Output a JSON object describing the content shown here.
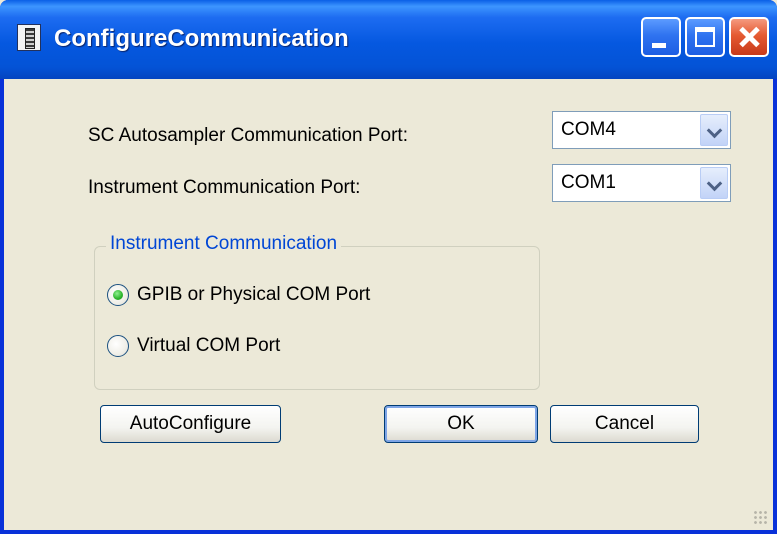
{
  "window": {
    "title": "ConfigureCommunication"
  },
  "form": {
    "autosampler_label": "SC Autosampler Communication Port:",
    "autosampler_value": "COM4",
    "instrument_label": "Instrument Communication Port:",
    "instrument_value": "COM1"
  },
  "group": {
    "legend": "Instrument Communication",
    "options": [
      {
        "label": "GPIB or Physical COM Port",
        "checked": true
      },
      {
        "label": "Virtual COM Port",
        "checked": false
      }
    ]
  },
  "buttons": {
    "autoconfigure": "AutoConfigure",
    "ok": "OK",
    "cancel": "Cancel"
  },
  "colors": {
    "titlebar": "#0558e0",
    "dialog_bg": "#ece9d8",
    "group_legend": "#0046d5",
    "close_button": "#e55a32"
  },
  "icons": {
    "app": "app-icon",
    "minimize": "minimize-icon",
    "maximize": "maximize-icon",
    "close": "close-icon",
    "dropdown": "chevron-down-icon"
  }
}
